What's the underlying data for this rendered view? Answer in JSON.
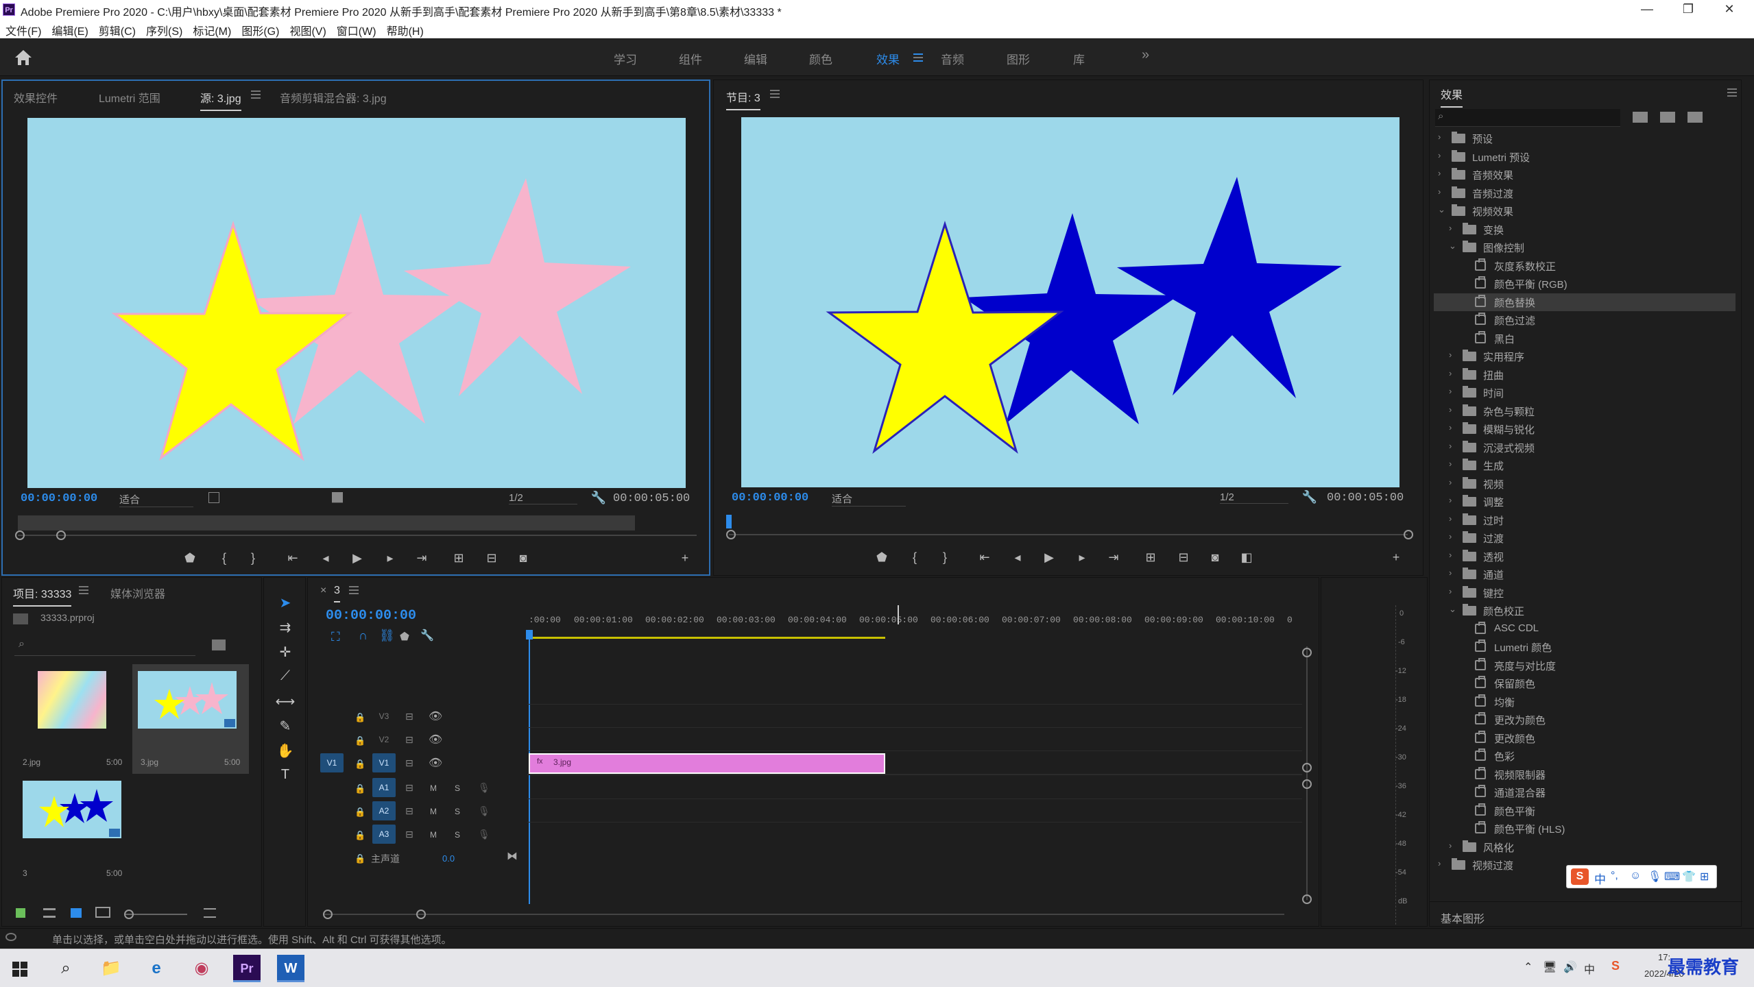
{
  "window": {
    "title": "Adobe Premiere Pro 2020 - C:\\用户\\hbxy\\桌面\\配套素材 Premiere Pro 2020 从新手到高手\\配套素材 Premiere Pro 2020 从新手到高手\\第8章\\8.5\\素材\\33333 *",
    "app_badge": "Pr",
    "minimize": "—",
    "restore": "❐",
    "close": "✕"
  },
  "menubar": [
    "文件(F)",
    "编辑(E)",
    "剪辑(C)",
    "序列(S)",
    "标记(M)",
    "图形(G)",
    "视图(V)",
    "窗口(W)",
    "帮助(H)"
  ],
  "workspaces": {
    "items": [
      "学习",
      "组件",
      "编辑",
      "颜色",
      "效果",
      "音频",
      "图形",
      "库"
    ],
    "active": "效果",
    "more": "»"
  },
  "source_panel": {
    "tabs": [
      "效果控件",
      "Lumetri 范围",
      "源: 3.jpg",
      "音频剪辑混合器: 3.jpg"
    ],
    "active_tab": "源: 3.jpg",
    "timecode_in": "00:00:00:00",
    "fit": "适合",
    "resolution": "1/2",
    "timecode_out": "00:00:05:00"
  },
  "program_panel": {
    "tab": "节目: 3",
    "timecode_in": "00:00:00:00",
    "fit": "适合",
    "resolution": "1/2",
    "timecode_out": "00:00:05:00"
  },
  "colors": {
    "preview_bg": "#9dd8ea",
    "star_yellow": "#ffff00",
    "star_pink": "#f7b4cc",
    "star_blue": "#0000cc",
    "accent": "#2d8ceb",
    "clip": "#e27ddc"
  },
  "project_panel": {
    "tabs": [
      "项目: 33333",
      "媒体浏览器"
    ],
    "file": "33333.prproj",
    "items": [
      {
        "name": "2.jpg",
        "duration": "5:00"
      },
      {
        "name": "3.jpg",
        "duration": "5:00"
      },
      {
        "name": "3",
        "duration": "5:00"
      }
    ]
  },
  "timeline": {
    "tab": "3",
    "timecode": "00:00:00:00",
    "ruler": [
      ":00:00",
      "00:00:01:00",
      "00:00:02:00",
      "00:00:03:00",
      "00:00:04:00",
      "00:00:05:00",
      "00:00:06:00",
      "00:00:07:00",
      "00:00:08:00",
      "00:00:09:00",
      "00:00:10:00",
      "0"
    ],
    "video_tracks": [
      "V3",
      "V2",
      "V1"
    ],
    "source_track": "V1",
    "audio_tracks": [
      "A1",
      "A2",
      "A3"
    ],
    "audio_m": "M",
    "audio_s": "S",
    "master": "主声道",
    "master_value": "0.0",
    "clip_name": "3.jpg",
    "clip_fx": "fx"
  },
  "vu_scale": [
    "0",
    "-6",
    "-12",
    "-18",
    "-24",
    "-30",
    "-36",
    "-42",
    "-48",
    "-54",
    "dB"
  ],
  "effects_panel": {
    "title": "效果",
    "tree": [
      {
        "label": "预设",
        "level": 0,
        "type": "folder",
        "open": false
      },
      {
        "label": "Lumetri 预设",
        "level": 0,
        "type": "folder",
        "open": false
      },
      {
        "label": "音频效果",
        "level": 0,
        "type": "folder",
        "open": false
      },
      {
        "label": "音频过渡",
        "level": 0,
        "type": "folder",
        "open": false
      },
      {
        "label": "视频效果",
        "level": 0,
        "type": "folder",
        "open": true
      },
      {
        "label": "变换",
        "level": 1,
        "type": "folder",
        "open": false
      },
      {
        "label": "图像控制",
        "level": 1,
        "type": "folder",
        "open": true
      },
      {
        "label": "灰度系数校正",
        "level": 2,
        "type": "fx"
      },
      {
        "label": "颜色平衡 (RGB)",
        "level": 2,
        "type": "fx"
      },
      {
        "label": "颜色替换",
        "level": 2,
        "type": "fx",
        "selected": true
      },
      {
        "label": "颜色过滤",
        "level": 2,
        "type": "fx"
      },
      {
        "label": "黑白",
        "level": 2,
        "type": "fx"
      },
      {
        "label": "实用程序",
        "level": 1,
        "type": "folder",
        "open": false
      },
      {
        "label": "扭曲",
        "level": 1,
        "type": "folder",
        "open": false
      },
      {
        "label": "时间",
        "level": 1,
        "type": "folder",
        "open": false
      },
      {
        "label": "杂色与颗粒",
        "level": 1,
        "type": "folder",
        "open": false
      },
      {
        "label": "模糊与锐化",
        "level": 1,
        "type": "folder",
        "open": false
      },
      {
        "label": "沉浸式视频",
        "level": 1,
        "type": "folder",
        "open": false
      },
      {
        "label": "生成",
        "level": 1,
        "type": "folder",
        "open": false
      },
      {
        "label": "视频",
        "level": 1,
        "type": "folder",
        "open": false
      },
      {
        "label": "调整",
        "level": 1,
        "type": "folder",
        "open": false
      },
      {
        "label": "过时",
        "level": 1,
        "type": "folder",
        "open": false
      },
      {
        "label": "过渡",
        "level": 1,
        "type": "folder",
        "open": false
      },
      {
        "label": "透视",
        "level": 1,
        "type": "folder",
        "open": false
      },
      {
        "label": "通道",
        "level": 1,
        "type": "folder",
        "open": false
      },
      {
        "label": "键控",
        "level": 1,
        "type": "folder",
        "open": false
      },
      {
        "label": "颜色校正",
        "level": 1,
        "type": "folder",
        "open": true
      },
      {
        "label": "ASC CDL",
        "level": 2,
        "type": "fx"
      },
      {
        "label": "Lumetri 颜色",
        "level": 2,
        "type": "fx"
      },
      {
        "label": "亮度与对比度",
        "level": 2,
        "type": "fx"
      },
      {
        "label": "保留颜色",
        "level": 2,
        "type": "fx"
      },
      {
        "label": "均衡",
        "level": 2,
        "type": "fx"
      },
      {
        "label": "更改为颜色",
        "level": 2,
        "type": "fx"
      },
      {
        "label": "更改颜色",
        "level": 2,
        "type": "fx"
      },
      {
        "label": "色彩",
        "level": 2,
        "type": "fx"
      },
      {
        "label": "视频限制器",
        "level": 2,
        "type": "fx"
      },
      {
        "label": "通道混合器",
        "level": 2,
        "type": "fx"
      },
      {
        "label": "颜色平衡",
        "level": 2,
        "type": "fx"
      },
      {
        "label": "颜色平衡 (HLS)",
        "level": 2,
        "type": "fx"
      },
      {
        "label": "风格化",
        "level": 1,
        "type": "folder",
        "open": false
      },
      {
        "label": "视频过渡",
        "level": 0,
        "type": "folder",
        "open": false
      }
    ],
    "essential_graphics": "基本图形"
  },
  "ime_toolbar": {
    "mode": "中"
  },
  "statusbar": "单击以选择，或单击空白处并拖动以进行框选。使用 Shift、Alt 和 Ctrl 可获得其他选项。",
  "taskbar": {
    "time": "17:",
    "date": "2022/4/20",
    "watermark": "最需教育",
    "apps": [
      "Pr",
      "W"
    ]
  }
}
